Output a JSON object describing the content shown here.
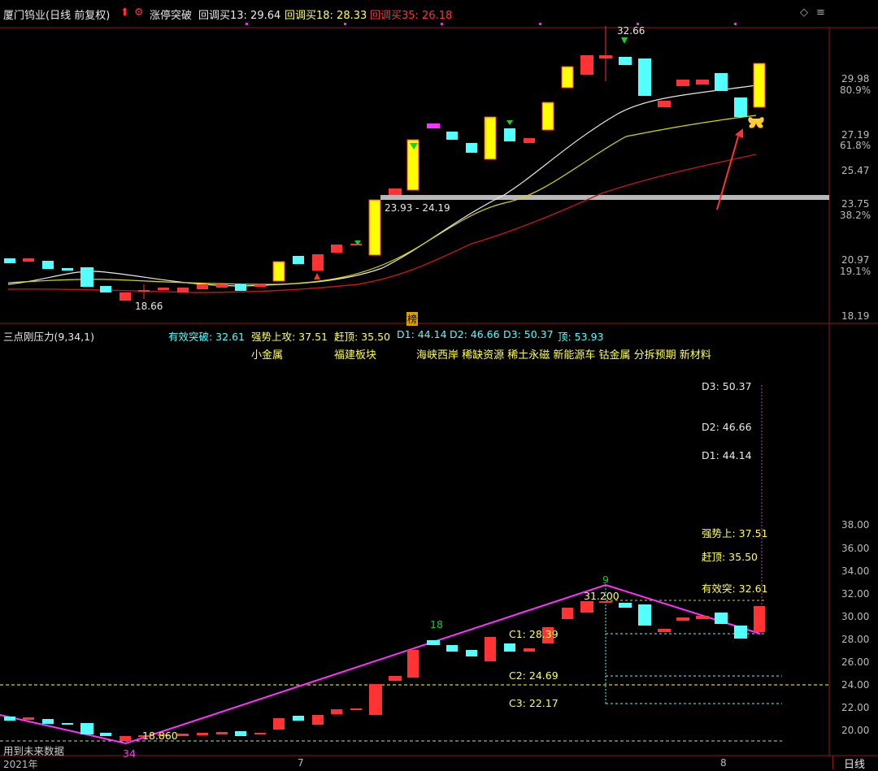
{
  "header": {
    "stock": "厦门钨业(日线 前复权)",
    "signal": "涨停突破",
    "ma13": "回调买13: 29.64",
    "ma18": "回调买18: 28.33",
    "ma35": "回调买35: 26.18",
    "diamond_icon": "diamond-icon",
    "menu_icon": "menu-icon"
  },
  "main_chart": {
    "price_labels": {
      "p2998": "29.98",
      "p809": "80.9%",
      "p2719": "27.19",
      "p618": "61.8%",
      "p2547": "25.47",
      "p2375": "23.75",
      "p382": "38.2%",
      "p2097": "20.97",
      "p191": "19.1%",
      "p1819": "18.19"
    },
    "high_label": "32.66",
    "low_label": "18.66",
    "zone_label": "23.93 - 24.19",
    "bang_label": "榜"
  },
  "indicator": {
    "name": "三点刚压力(9,34,1)",
    "items": {
      "effective": "有效突破: 32.61",
      "strong": "强势上攻: 37.51",
      "catch": "赶顶: 35.50",
      "d1": "D1: 44.14",
      "d2": "D2: 46.66",
      "d3": "D3: 50.37",
      "top": "顶: 53.93"
    },
    "concepts": {
      "c1": "小金属",
      "c2": "福建板块",
      "c3": "海峡西岸 稀缺资源 稀土永磁 新能源车 钴金属 分拆预期 新材料"
    },
    "right_labels": {
      "d3": "D3: 50.37",
      "d2": "D2: 46.66",
      "d1": "D1: 44.14",
      "strong": "强势上: 37.51",
      "catch": "赶顶: 35.50",
      "effective": "有效突: 32.61"
    },
    "c_labels": {
      "c1": "C1: 28.39",
      "c2": "C2: 24.69",
      "c3": "C3: 22.17"
    },
    "peak_value": "31.200",
    "low_value": "18.860",
    "count_18": "18",
    "count_9": "9",
    "count_34": "34",
    "axis": {
      "a38": "38.00",
      "a36": "36.00",
      "a34": "34.00",
      "a32": "32.00",
      "a30": "30.00",
      "a28": "28.00",
      "a26": "26.00",
      "a24": "24.00",
      "a22": "22.00",
      "a20": "20.00"
    },
    "warning": "用到未来数据"
  },
  "time_axis": {
    "year": "2021年",
    "m7": "7",
    "m8": "8",
    "period": "日线"
  },
  "colors": {
    "up": "#ff3333",
    "down": "#54ffff",
    "limit": "#ffff00",
    "ma_white": "#e8e8e8",
    "ma_yellow": "#d8d800",
    "ma_red": "#c01818",
    "magenta": "#ff33ff"
  }
}
